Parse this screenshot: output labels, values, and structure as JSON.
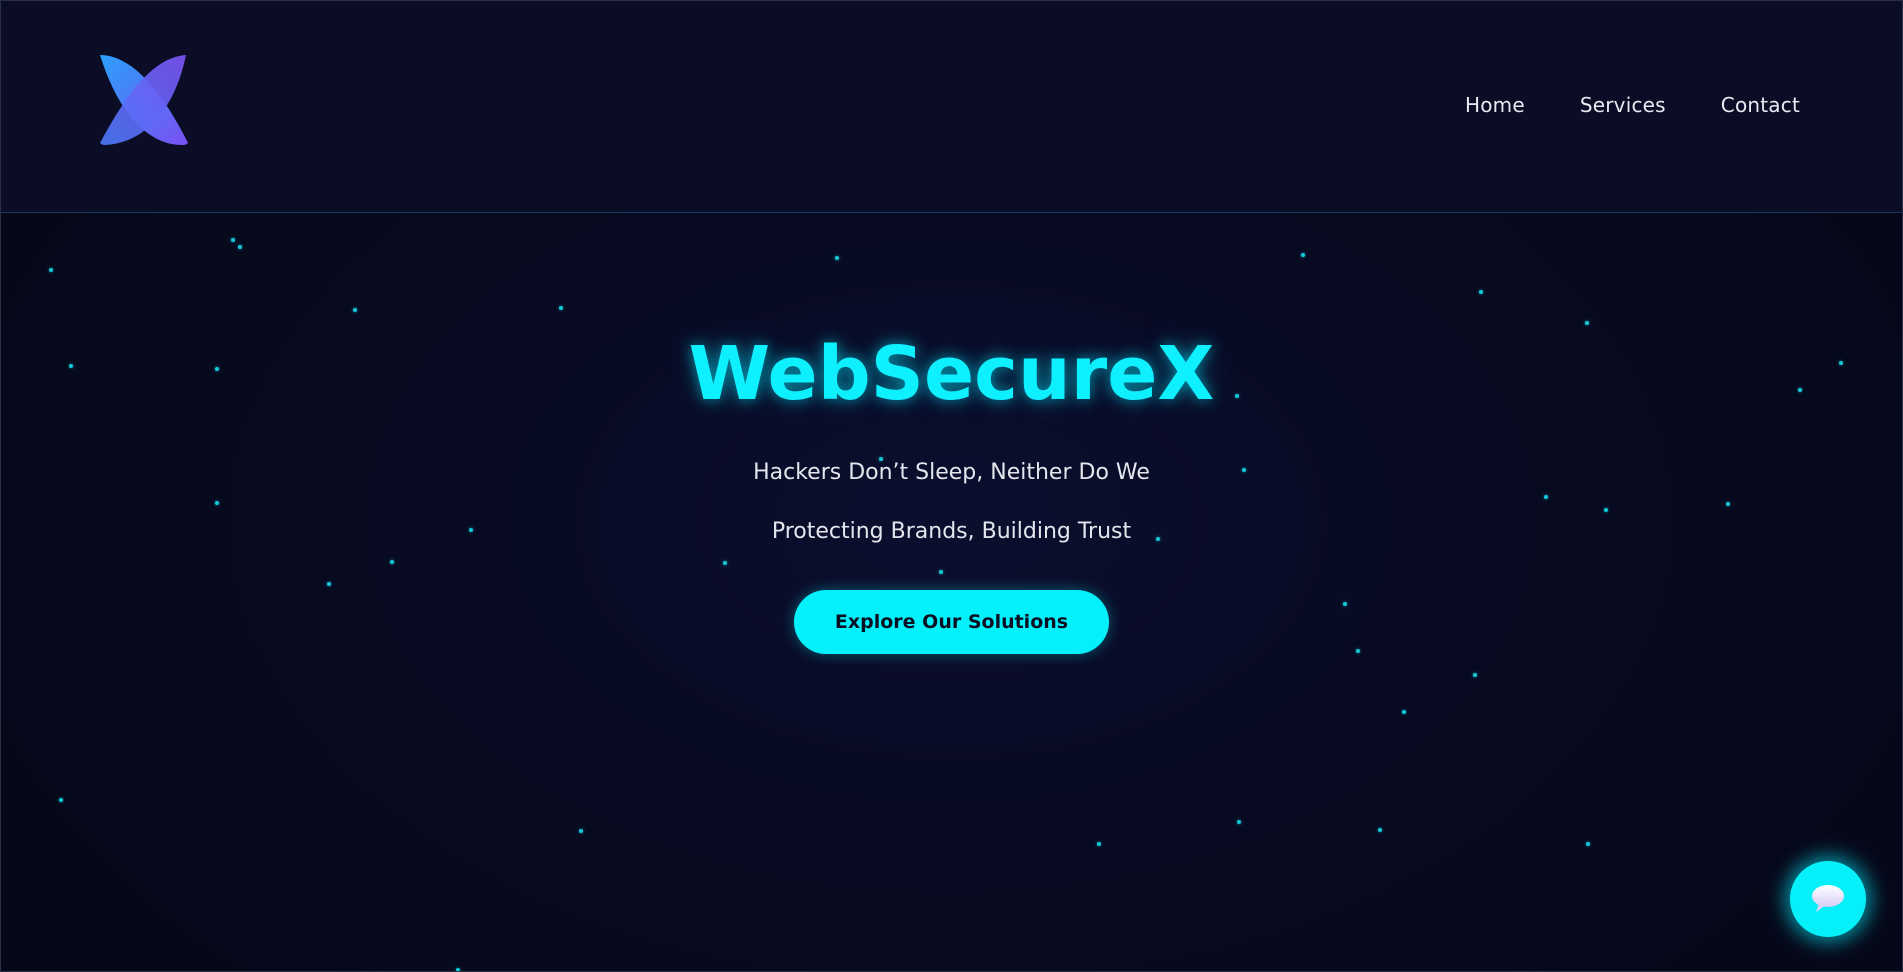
{
  "header": {
    "logo_name": "x-logo",
    "nav": [
      {
        "label": "Home"
      },
      {
        "label": "Services"
      },
      {
        "label": "Contact"
      }
    ]
  },
  "hero": {
    "title": "WebSecureX",
    "tagline": "Hackers Don’t Sleep, Neither Do We",
    "subtitle": "Protecting Brands, Building Trust",
    "cta_label": "Explore Our Solutions"
  },
  "chat": {
    "icon": "chat-bubble-icon"
  },
  "colors": {
    "accent": "#04f1fb",
    "background": "#070a1e",
    "particle": "#14c8d8",
    "logo_gradient_start": "#2f8dfa",
    "logo_gradient_end": "#7b4ff2"
  }
}
